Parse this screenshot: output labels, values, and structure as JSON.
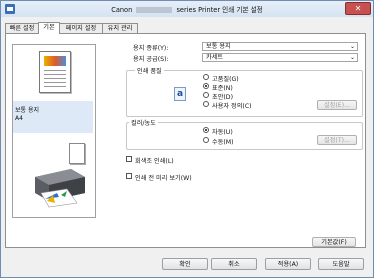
{
  "window": {
    "title_prefix": "Canon",
    "title_suffix": "series Printer 인쇄 기본 설정",
    "close_glyph": "✕"
  },
  "tabs": [
    {
      "label": "빠른 설정",
      "active": false
    },
    {
      "label": "기본",
      "active": true
    },
    {
      "label": "페이지 설정",
      "active": false
    },
    {
      "label": "유지 관리",
      "active": false
    }
  ],
  "preview": {
    "media_label": "보통 용지",
    "size_label": "A4"
  },
  "media": {
    "type_label": "용지 종류(Y):",
    "type_value": "보통 용지",
    "source_label": "용지 공급(S):",
    "source_value": "카세트"
  },
  "quality": {
    "group_title": "인쇄 품질",
    "options": [
      "고품질(G)",
      "표준(N)",
      "초안(D)",
      "사용자 정의(C)"
    ],
    "selected_index": 1,
    "settings_button": "설정(E)..."
  },
  "color": {
    "group_title": "컬러/농도",
    "options": [
      "자동(U)",
      "수동(M)"
    ],
    "selected_index": 0,
    "settings_button": "설정(T)..."
  },
  "checkboxes": {
    "grayscale": {
      "label": "회색조 인쇄(L)",
      "checked": false
    },
    "preview_before": {
      "label": "인쇄 전 미리 보기(W)",
      "checked": false
    }
  },
  "buttons": {
    "defaults": "기본값(F)",
    "ok": "확인",
    "cancel": "취소",
    "apply": "적용(A)",
    "help": "도움말"
  },
  "icons": {
    "dropdown_arrow": "⌄",
    "quality_icon_glyph": "a"
  }
}
